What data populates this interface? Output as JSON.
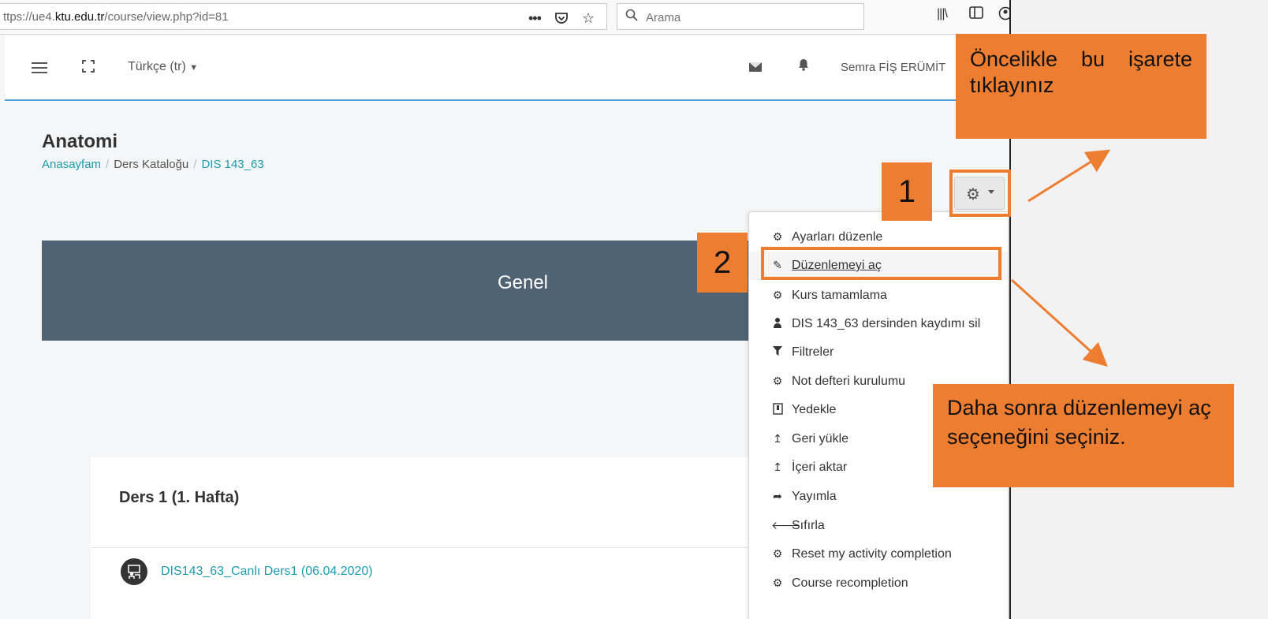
{
  "browser": {
    "url_prefix": "ttps://ue4.",
    "url_domain": "ktu.edu.tr",
    "url_path": "/course/view.php?id=81",
    "search_placeholder": "Arama",
    "toolbar_icons": [
      "more-icon",
      "pocket-icon",
      "bookmark-star-icon",
      "library-icon",
      "sidebar-icon",
      "account-icon"
    ]
  },
  "navbar": {
    "language": "Türkçe (tr)",
    "user_name": "Semra FİŞ ERÜMİT"
  },
  "page": {
    "title": "Anatomi",
    "breadcrumb": [
      "Anasayfam",
      "Ders Kataloğu",
      "DIS 143_63"
    ]
  },
  "section_banner": {
    "title": "Genel"
  },
  "course_section": {
    "title": "Ders 1 (1. Hafta)",
    "activity": "DIS143_63_Canlı Ders1 (06.04.2020)"
  },
  "actions_menu": {
    "items": [
      {
        "label": "Ayarları düzenle",
        "icon": "gear-icon"
      },
      {
        "label": "Düzenlemeyi aç",
        "icon": "pencil-icon"
      },
      {
        "label": "Kurs tamamlama",
        "icon": "gear-icon"
      },
      {
        "label": "DIS 143_63 dersinden kaydımı sil",
        "icon": "user-icon"
      },
      {
        "label": "Filtreler",
        "icon": "filter-icon"
      },
      {
        "label": "Not defteri kurulumu",
        "icon": "gear-icon"
      },
      {
        "label": "Yedekle",
        "icon": "archive-icon"
      },
      {
        "label": "Geri yükle",
        "icon": "upload-icon"
      },
      {
        "label": "İçeri aktar",
        "icon": "upload-icon"
      },
      {
        "label": "Yayımla",
        "icon": "share-icon"
      },
      {
        "label": "Sıfırla",
        "icon": "arrow-left-icon"
      },
      {
        "label": "Reset my activity completion",
        "icon": "gear-icon"
      },
      {
        "label": "Course recompletion",
        "icon": "gear-icon"
      }
    ]
  },
  "annotations": {
    "top_callout": "Öncelikle bu işarete tıklayınız",
    "bottom_callout": "Daha sonra düzenlemeyi aç seçeneğini seçiniz.",
    "step1": "1",
    "step2": "2",
    "color": "#ed7d31"
  }
}
